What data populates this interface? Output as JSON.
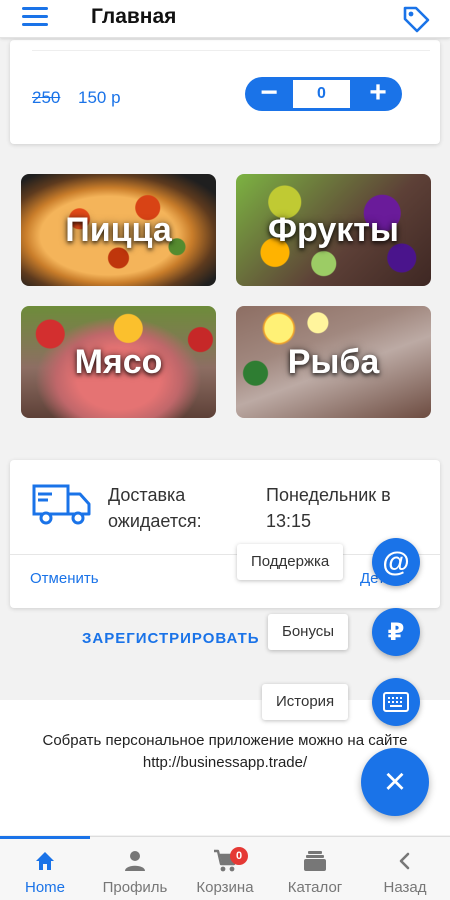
{
  "header": {
    "title": "Главная",
    "menu_icon": "hamburger-menu-icon",
    "tag_icon": "tag-icon"
  },
  "product": {
    "old_price": "250",
    "new_price": "150 р",
    "quantity": "0",
    "minus_label": "−",
    "plus_label": "+"
  },
  "categories": [
    {
      "label": "Пицца"
    },
    {
      "label": "Фрукты"
    },
    {
      "label": "Мясо"
    },
    {
      "label": "Рыба"
    }
  ],
  "delivery": {
    "label": "Доставка ожидается:",
    "time": "Понедельник в 13:15",
    "cancel": "Отменить",
    "details": "Детали"
  },
  "register_label": "ЗАРЕГИСТРИРОВАТЬ",
  "footer_text": "Собрать персональное приложение можно на сайте http://businessapp.trade/",
  "fab": {
    "support": "Поддержка",
    "bonuses": "Бонусы",
    "history": "История",
    "support_symbol": "@",
    "bonuses_symbol": "₽",
    "close_symbol": "×"
  },
  "bottom_nav": {
    "items": [
      {
        "label": "Home",
        "icon": "home-icon"
      },
      {
        "label": "Профиль",
        "icon": "profile-icon"
      },
      {
        "label": "Корзина",
        "icon": "cart-icon"
      },
      {
        "label": "Каталог",
        "icon": "catalog-icon"
      },
      {
        "label": "Назад",
        "icon": "back-icon"
      }
    ],
    "cart_badge": "0"
  },
  "colors": {
    "accent": "#1a73e8",
    "badge": "#e53935"
  }
}
